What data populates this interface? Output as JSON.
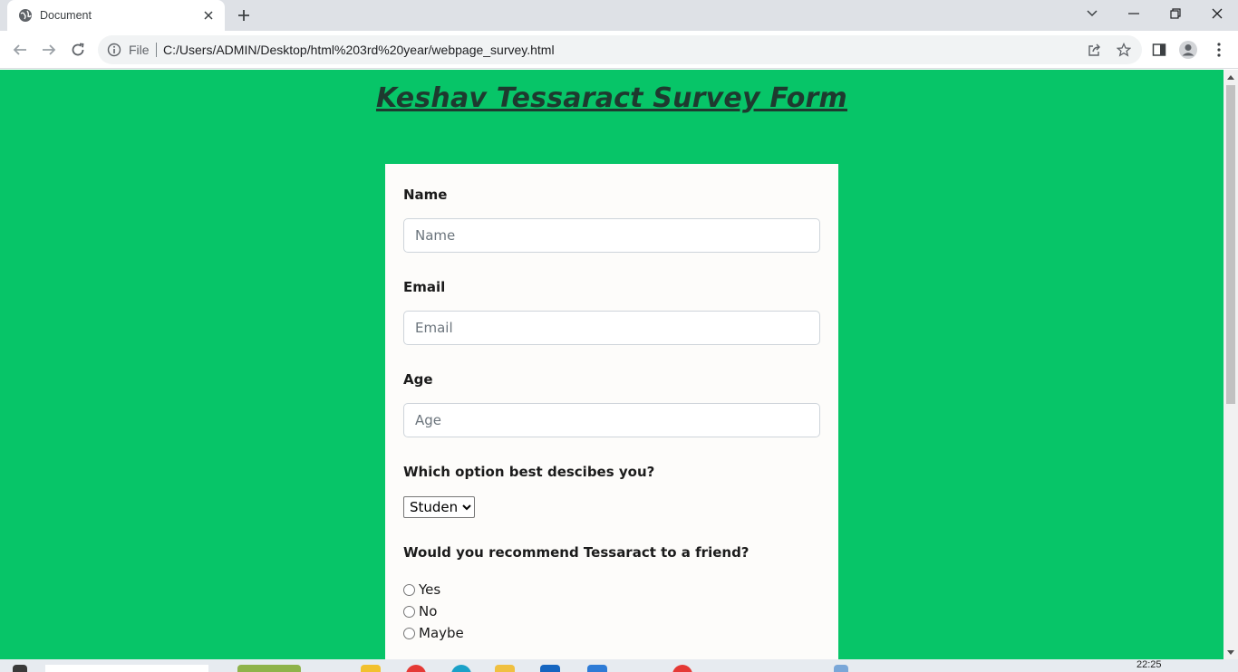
{
  "browser": {
    "tab": {
      "title": "Document",
      "favicon": "globe-icon"
    },
    "address_bar": {
      "scheme_label": "File",
      "url": "C:/Users/ADMIN/Desktop/html%203rd%20year/webpage_survey.html"
    }
  },
  "page": {
    "background_color": "#07c568",
    "title": "Keshav Tessaract Survey Form"
  },
  "form": {
    "name": {
      "label": "Name",
      "placeholder": "Name",
      "value": ""
    },
    "email": {
      "label": "Email",
      "placeholder": "Email",
      "value": ""
    },
    "age": {
      "label": "Age",
      "placeholder": "Age",
      "value": ""
    },
    "role": {
      "label": "Which option best descibes you?",
      "selected": "Student"
    },
    "recommend": {
      "label": "Would you recommend Tessaract to a friend?",
      "options": [
        "Yes",
        "No",
        "Maybe"
      ]
    }
  },
  "taskbar": {
    "clock": "22:25"
  }
}
